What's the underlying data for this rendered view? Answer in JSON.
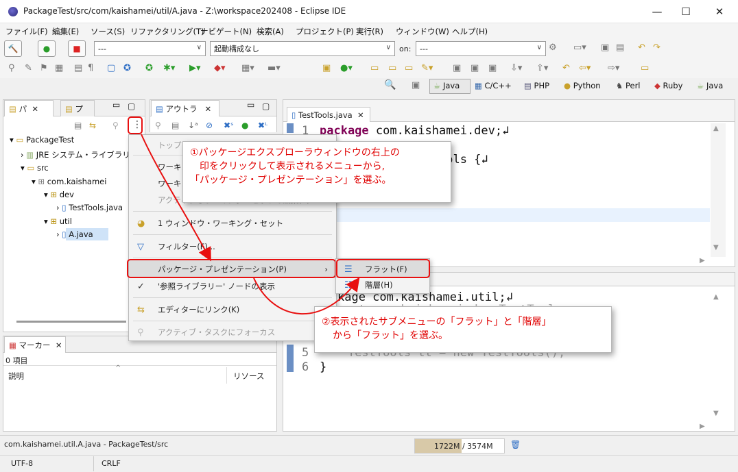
{
  "window": {
    "title": "PackageTest/src/com/kaishamei/util/A.java - Z:\\workspace202408 - Eclipse IDE",
    "minimize": "—",
    "maximize": "☐",
    "close": "✕"
  },
  "menubar": [
    "ファイル(F)",
    "編集(E)",
    "ソース(S)",
    "リファクタリング(T)",
    "ナビゲート(N)",
    "検索(A)",
    "プロジェクト(P)",
    "実行(R)",
    "ウィンドウ(W)",
    "ヘルプ(H)"
  ],
  "toolbar": {
    "combo1_value": "---",
    "combo2_value": "起動構成なし",
    "on_label": "on:",
    "combo3_value": "---"
  },
  "perspectives": [
    "Java",
    "C/C++",
    "PHP",
    "Python",
    "Perl",
    "Ruby",
    "Java"
  ],
  "left_panel": {
    "tab1": "パ",
    "tab2": "プ",
    "tree": [
      {
        "label": "PackageTest",
        "icon": "▾"
      },
      {
        "label": "JRE システム・ライブラリー",
        "icon": "›"
      },
      {
        "label": "src",
        "icon": "▾"
      },
      {
        "label": "com.kaishamei",
        "icon": "▾"
      },
      {
        "label": "dev",
        "icon": "▾"
      },
      {
        "label": "TestTools.java",
        "icon": "›"
      },
      {
        "label": "util",
        "icon": "▾"
      },
      {
        "label": "A.java",
        "icon": "›"
      }
    ]
  },
  "outline_panel": {
    "tab": "アウトラ"
  },
  "markers_panel": {
    "tab": "マーカー",
    "count": "0 項目",
    "col_description": "説明",
    "col_resource": "リソース"
  },
  "editor1": {
    "tab": "TestTools.java",
    "lines": [
      {
        "num": "1",
        "kw": "package",
        "rest": " com.kaishamei.dev;↲"
      },
      {
        "num": "",
        "kw": "",
        "rest": "              stTools {↲"
      }
    ]
  },
  "editor2": {
    "lines": [
      {
        "num": "",
        "kw": "",
        "rest": "kage com.kaishamei.util;↲"
      },
      {
        "num": "",
        "kw": "",
        "rest": "port com.kaishamei.dev.TestTools;"
      },
      {
        "num": "5",
        "kw": "",
        "rest": "    TestTools tt = new TestTools();"
      },
      {
        "num": "6",
        "kw": "",
        "rest": "}"
      }
    ]
  },
  "view_menu": {
    "items": [
      {
        "label": "トップ・レベル要素(T)",
        "disabled": true
      },
      {
        "label": "ワーキング・セット(W)",
        "disabled": false
      },
      {
        "label": "ワーキング・セットの選択(S)",
        "disabled": false
      },
      {
        "label": "アクティブなワーキング・セットの編集(E)",
        "disabled": true
      },
      {
        "label": "1 ウィンドウ・ワーキング・セット",
        "disabled": false
      },
      {
        "label": "フィルター(F)...",
        "disabled": false
      },
      {
        "label": "パッケージ・プレゼンテーション(P)",
        "disabled": false
      },
      {
        "label": "'参照ライブラリー' ノードの表示",
        "disabled": false
      },
      {
        "label": "エディターにリンク(K)",
        "disabled": false
      },
      {
        "label": "アクティブ・タスクにフォーカス",
        "disabled": true
      }
    ],
    "submenu": [
      "フラット(F)",
      "階層(H)"
    ]
  },
  "callouts": {
    "c1_line1": "①パッケージエクスプローラウィンドウの右上の",
    "c1_line2": "　印をクリックして表示されるメニューから,",
    "c1_line3": "「パッケージ・プレゼンテーション」を選ぶ。",
    "c2_line1": "②表示されたサブメニューの「フラット」と「階層」",
    "c2_line2": "から「フラット」を選ぶ。"
  },
  "statusbar": {
    "path": "com.kaishamei.util.A.java - PackageTest/src",
    "heap": "1722M / 3574M",
    "encoding": "UTF-8",
    "line_ending": "CRLF"
  },
  "colors": {
    "callout_red": "#e00000",
    "highlight_red": "#e81010",
    "menu_bg": "#f3f3f3"
  }
}
